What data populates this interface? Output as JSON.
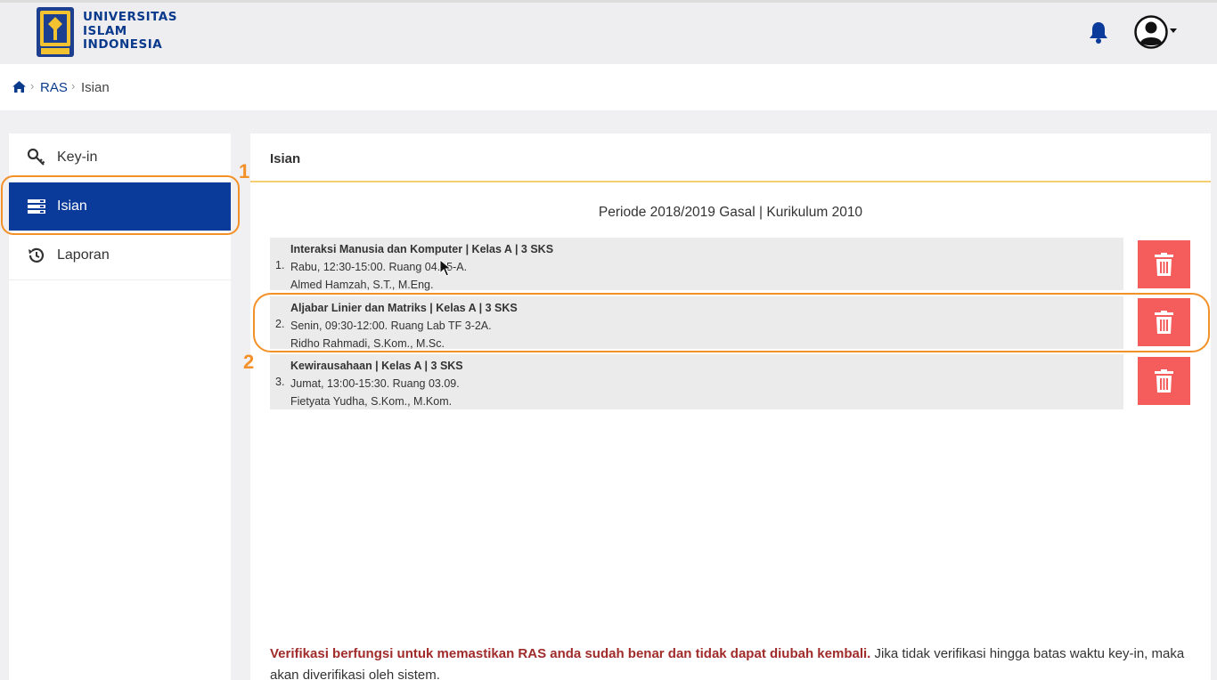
{
  "header": {
    "logo_text": [
      "UNIVERSITAS",
      "ISLAM",
      "INDONESIA"
    ],
    "icons": [
      "bell-icon",
      "user-avatar-icon",
      "caret-down-icon"
    ],
    "brand_color": "#0a3a8c"
  },
  "breadcrumb": {
    "home_icon": "home-icon",
    "items": [
      "RAS",
      "Isian"
    ]
  },
  "sidebar": {
    "items": [
      {
        "label": "Key-in",
        "icon": "key-icon",
        "active": false
      },
      {
        "label": "Isian",
        "icon": "list-icon",
        "active": true
      },
      {
        "label": "Laporan",
        "icon": "history-icon",
        "active": false
      }
    ],
    "active_color": "#0a3a9a"
  },
  "annotations": {
    "marker_1": "1",
    "marker_2": "2",
    "color": "#f39128"
  },
  "main": {
    "title": "Isian",
    "period": "Periode 2018/2019 Gasal | Kurikulum 2010",
    "courses": [
      {
        "index": "1.",
        "title": "Interaksi Manusia dan Komputer | Kelas A | 3 SKS",
        "schedule": "Rabu, 12:30-15:00. Ruang 04.05-A.",
        "lecturer": "Almed Hamzah, S.T., M.Eng."
      },
      {
        "index": "2.",
        "title": "Aljabar Linier dan Matriks | Kelas A | 3 SKS",
        "schedule": "Senin, 09:30-12:00. Ruang Lab TF 3-2A.",
        "lecturer": "Ridho Rahmadi, S.Kom., M.Sc."
      },
      {
        "index": "3.",
        "title": "Kewirausahaan | Kelas A | 3 SKS",
        "schedule": "Jumat, 13:00-15:30. Ruang 03.09.",
        "lecturer": "Fietyata Yudha, S.Kom., M.Kom."
      }
    ],
    "delete_icon": "trash-icon",
    "delete_color": "#f55d5d",
    "note_strong": "Verifikasi berfungsi untuk memastikan RAS anda sudah benar dan tidak dapat diubah kembali.",
    "note_rest": " Jika tidak verifikasi hingga batas waktu key-in, maka akan diverifikasi oleh sistem."
  }
}
